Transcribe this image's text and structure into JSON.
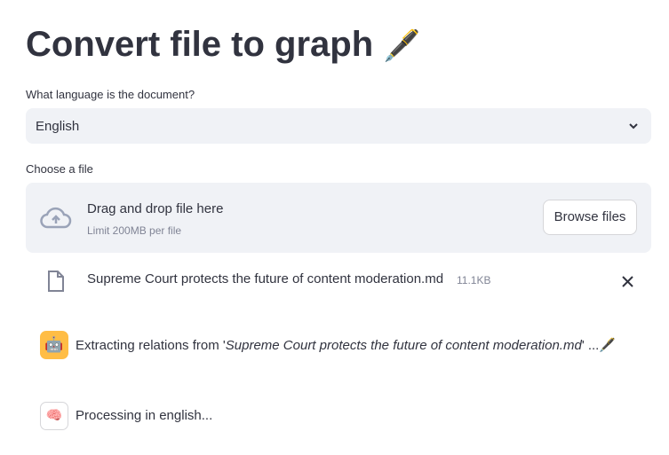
{
  "title": "Convert file to graph",
  "title_emoji": "🖋️",
  "language": {
    "label": "What language is the document?",
    "value": "English"
  },
  "uploader": {
    "label": "Choose a file",
    "drop_text": "Drag and drop file here",
    "limit": "Limit 200MB per file",
    "browse": "Browse files"
  },
  "file": {
    "name": "Supreme Court protects the future of content moderation.md",
    "size": "11.1KB"
  },
  "messages": [
    {
      "prefix": "Extracting relations from '",
      "filename": "Supreme Court protects the future of content moderation.md",
      "suffix": "' ...",
      "emoji": "🖋️",
      "avatar": "🤖"
    },
    {
      "text": "Processing in english...",
      "avatar": "🧠"
    }
  ]
}
